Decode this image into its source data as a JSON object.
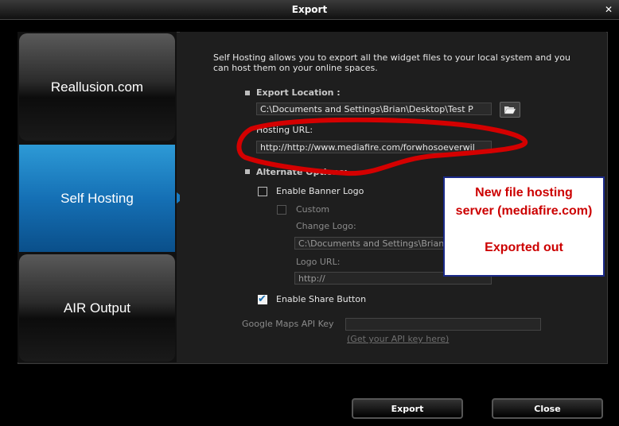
{
  "window": {
    "title": "Export"
  },
  "sidebar": {
    "items": [
      {
        "label": "Reallusion.com"
      },
      {
        "label": "Self Hosting"
      },
      {
        "label": "AIR Output"
      }
    ]
  },
  "main": {
    "description": "Self Hosting allows you to export all the widget files to your local system and you can host them on your online spaces.",
    "export_location": {
      "label": "Export Location :",
      "value": "C:\\Documents and Settings\\Brian\\Desktop\\Test P"
    },
    "hosting_url": {
      "label": "Hosting URL:",
      "value": "http://http://www.mediafire.com/forwhosoeverwil"
    },
    "alternate_options": {
      "label": "Alternate Options:"
    },
    "enable_banner_logo": {
      "label": "Enable Banner Logo",
      "checked": false
    },
    "custom": {
      "label": "Custom",
      "checked": false
    },
    "change_logo": {
      "label": "Change Logo:",
      "value": "C:\\Documents and Settings\\Brian"
    },
    "logo_url": {
      "label": "Logo URL:",
      "value": "http://"
    },
    "enable_share_button": {
      "label": "Enable Share Button",
      "checked": true
    },
    "google_maps": {
      "label": "Google Maps API Key",
      "value": "",
      "link": "(Get your API key here)"
    }
  },
  "annotation": {
    "line1": "New file hosting",
    "line2": "server (mediafire.com)",
    "line3": "Exported out",
    "color": "#cc0000"
  },
  "buttons": {
    "export": "Export",
    "close": "Close"
  },
  "colors": {
    "accent": "#1570b5",
    "annotation_border": "#1b2a8a"
  }
}
